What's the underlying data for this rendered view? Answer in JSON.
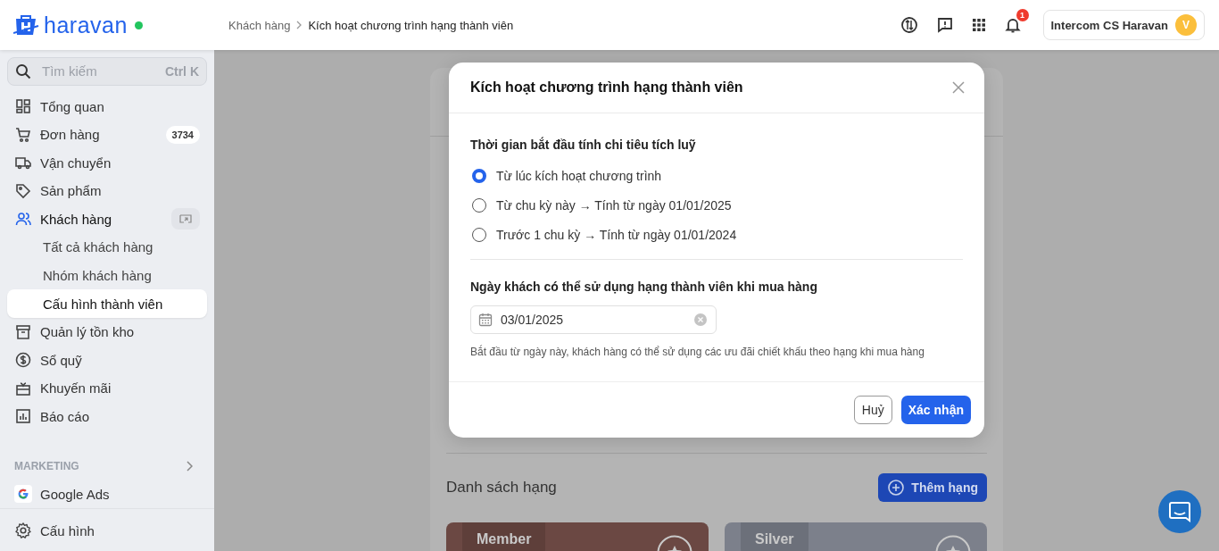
{
  "header": {
    "brand": "haravan",
    "online": true,
    "breadcrumb": [
      {
        "label": "Khách hàng"
      },
      {
        "label": "Kích hoạt chương trình hạng thành viên"
      }
    ],
    "notifications": "1",
    "user": {
      "name": "Intercom CS Haravan",
      "initial": "V"
    }
  },
  "sidebar": {
    "search": {
      "placeholder": "Tìm kiếm",
      "shortcut": "Ctrl K"
    },
    "items": [
      {
        "label": "Tổng quan",
        "selected": false
      },
      {
        "label": "Đơn hàng",
        "selected": false,
        "badge": "3734"
      },
      {
        "label": "Vận chuyển",
        "selected": false
      },
      {
        "label": "Sản phẩm",
        "selected": false
      },
      {
        "label": "Khách hàng",
        "selected": false,
        "active": true,
        "children": [
          {
            "label": "Tất cả khách hàng",
            "selected": false
          },
          {
            "label": "Nhóm khách hàng",
            "selected": false
          },
          {
            "label": "Cấu hình thành viên",
            "selected": true
          }
        ]
      },
      {
        "label": "Quản lý tồn kho",
        "selected": false
      },
      {
        "label": "Sổ quỹ",
        "selected": false
      },
      {
        "label": "Khuyến mãi",
        "selected": false
      },
      {
        "label": "Báo cáo",
        "selected": false
      }
    ],
    "section": {
      "title": "MARKETING",
      "items": [
        {
          "label": "Google Ads",
          "selected": false
        }
      ]
    },
    "footer": {
      "label": "Cấu hình",
      "selected": false
    }
  },
  "page": {
    "tiers_title": "Danh sách hạng",
    "add_button": "Thêm hạng",
    "tiers": [
      {
        "name": "Member",
        "color": "#6b4843"
      },
      {
        "name": "Silver",
        "color": "#7c808b"
      }
    ]
  },
  "modal": {
    "title": "Kích hoạt chương trình hạng thành viên",
    "question": "Thời gian bắt đầu tính chi tiêu tích luỹ",
    "options": [
      {
        "label": "Từ lúc kích hoạt chương trình",
        "selected": true
      },
      {
        "label": "Từ chu kỳ này → Tính từ ngày 01/01/2025",
        "selected": false
      },
      {
        "label": "Trước 1 chu kỳ → Tính từ ngày 01/01/2024",
        "selected": false
      }
    ],
    "date_label": "Ngày khách có thể sử dụng hạng thành viên khi mua hàng",
    "date_value": "03/01/2025",
    "hint": "Bắt đầu từ ngày này, khách hàng có thể sử dụng các ưu đãi chiết khấu theo hạng khi mua hàng",
    "cancel": "Huỷ",
    "confirm": "Xác nhận"
  }
}
